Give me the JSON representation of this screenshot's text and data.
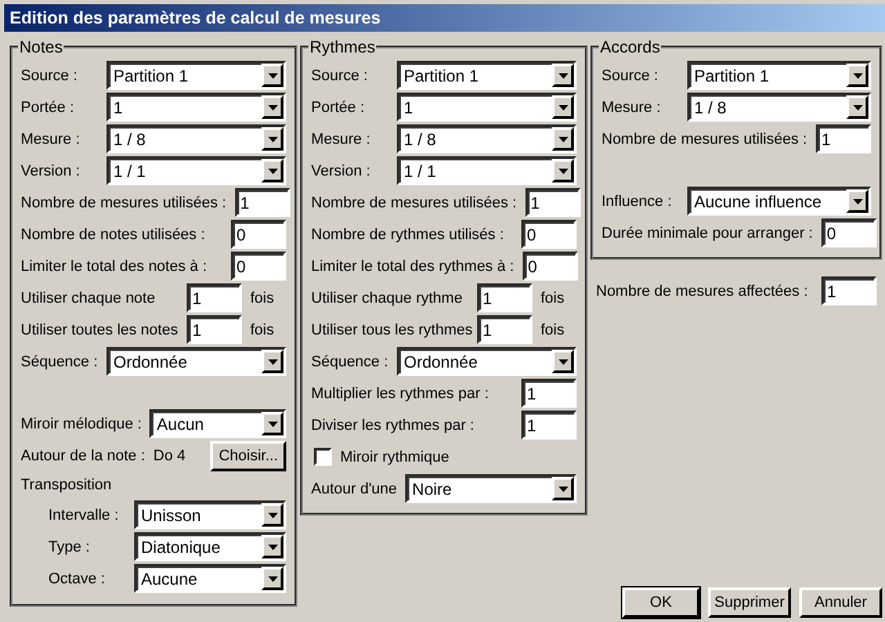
{
  "window": {
    "title": "Edition des paramètres de calcul de mesures"
  },
  "groups": [
    {
      "title": "Notes",
      "sections": [
        [
          {
            "kind": "select",
            "label": "Source :",
            "value": "Partition 1"
          },
          {
            "kind": "select",
            "label": "Portée :",
            "value": "1"
          },
          {
            "kind": "select",
            "label": "Mesure :",
            "value": "1 / 8"
          },
          {
            "kind": "select",
            "label": "Version :",
            "value": "1 / 1"
          },
          {
            "kind": "input",
            "label": "Nombre de mesures utilisées :",
            "value": "1"
          },
          {
            "kind": "input",
            "label": "Nombre de notes utilisées :",
            "value": "0"
          },
          {
            "kind": "input",
            "label": "Limiter le total des notes à :",
            "value": "0"
          },
          {
            "kind": "times",
            "label": "Utiliser chaque note",
            "value": "1",
            "unit": "fois"
          },
          {
            "kind": "times",
            "label": "Utiliser toutes les notes",
            "value": "1",
            "unit": "fois"
          },
          {
            "kind": "select",
            "label": "Séquence :",
            "value": "Ordonnée"
          }
        ],
        [
          {
            "kind": "select",
            "label": "Miroir mélodique :",
            "value": "Aucun"
          },
          {
            "kind": "note",
            "label": "Autour de la note :",
            "value": "Do 4",
            "button": "Choisir..."
          },
          {
            "kind": "heading",
            "label": "Transposition",
            "children": [
              {
                "kind": "select",
                "label": "Intervalle :",
                "value": "Unisson"
              },
              {
                "kind": "select",
                "label": "Type :",
                "value": "Diatonique"
              },
              {
                "kind": "select",
                "label": "Octave :",
                "value": "Aucune"
              }
            ]
          }
        ]
      ]
    },
    {
      "title": "Rythmes",
      "sections": [
        [
          {
            "kind": "select",
            "label": "Source :",
            "value": "Partition 1"
          },
          {
            "kind": "select",
            "label": "Portée :",
            "value": "1"
          },
          {
            "kind": "select",
            "label": "Mesure :",
            "value": "1 / 8"
          },
          {
            "kind": "select",
            "label": "Version :",
            "value": "1 / 1"
          },
          {
            "kind": "input",
            "label": "Nombre de mesures utilisées :",
            "value": "1"
          },
          {
            "kind": "input",
            "label": "Nombre de rythmes utilisés :",
            "value": "0"
          },
          {
            "kind": "input",
            "label": "Limiter le total des rythmes à :",
            "value": "0"
          },
          {
            "kind": "times",
            "label": "Utiliser chaque rythme",
            "value": "1",
            "unit": "fois"
          },
          {
            "kind": "times",
            "label": "Utiliser tous les rythmes",
            "value": "1",
            "unit": "fois"
          },
          {
            "kind": "select",
            "label": "Séquence :",
            "value": "Ordonnée"
          },
          {
            "kind": "input",
            "label": "Multiplier les rythmes par :",
            "value": "1"
          },
          {
            "kind": "input",
            "label": "Diviser les rythmes par :",
            "value": "1"
          },
          {
            "kind": "checkbox",
            "label": "Miroir rythmique",
            "checked": false
          },
          {
            "kind": "select",
            "label": "Autour d'une",
            "value": "Noire"
          }
        ]
      ]
    },
    {
      "title": "Accords",
      "sections": [
        [
          {
            "kind": "select",
            "label": "Source :",
            "value": "Partition 1"
          },
          {
            "kind": "select",
            "label": "Mesure :",
            "value": "1 / 8"
          },
          {
            "kind": "input",
            "label": "Nombre de mesures utilisées :",
            "value": "1"
          }
        ],
        [
          {
            "kind": "select",
            "label": "Influence :",
            "value": "Aucune influence"
          },
          {
            "kind": "input",
            "label": "Durée minimale pour arranger :",
            "value": "0"
          }
        ]
      ]
    }
  ],
  "affected": {
    "label": "Nombre de mesures affectées :",
    "value": "1"
  },
  "buttons": [
    {
      "label": "OK",
      "default": true
    },
    {
      "label": "Supprimer",
      "default": false
    },
    {
      "label": "Annuler",
      "default": false
    }
  ]
}
